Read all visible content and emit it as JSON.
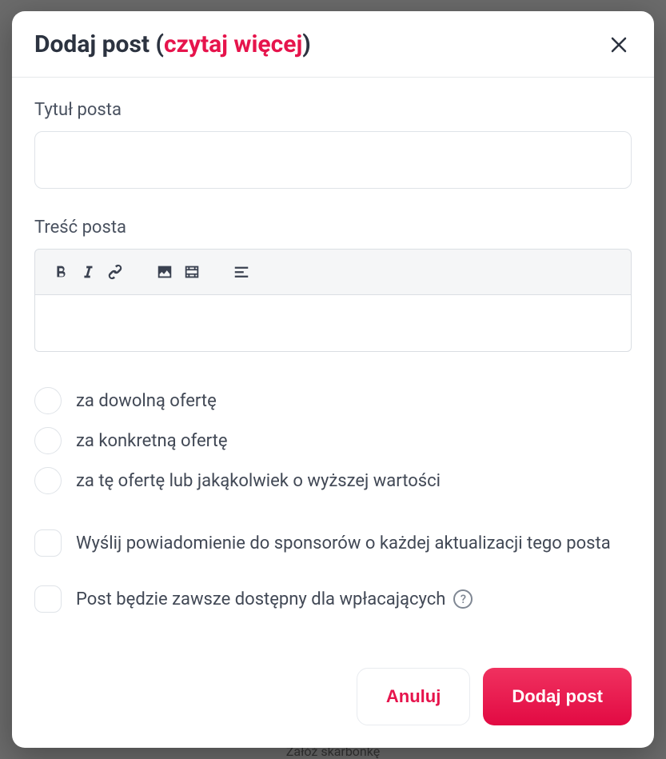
{
  "modal": {
    "title_prefix": "Dodaj post ",
    "title_paren_open": "(",
    "title_link": "czytaj więcej",
    "title_paren_close": ")"
  },
  "fields": {
    "title_label": "Tytuł posta",
    "title_value": "",
    "content_label": "Treść posta"
  },
  "toolbar": {
    "bold": "bold",
    "italic": "italic",
    "link": "link",
    "image": "image",
    "video": "video",
    "align": "align"
  },
  "radios": [
    {
      "label": "za dowolną ofertę"
    },
    {
      "label": "za konkretną ofertę"
    },
    {
      "label": "za tę ofertę lub jakąkolwiek o wyższej wartości"
    }
  ],
  "checkboxes": [
    {
      "label": "Wyślij powiadomienie do sponsorów o każdej aktualizacji tego posta",
      "help": false
    },
    {
      "label": "Post będzie zawsze dostępny dla wpłacających",
      "help": true
    }
  ],
  "footer": {
    "cancel": "Anuluj",
    "submit": "Dodaj post"
  },
  "help_glyph": "?",
  "background_hint": "Załóż skarbonkę"
}
